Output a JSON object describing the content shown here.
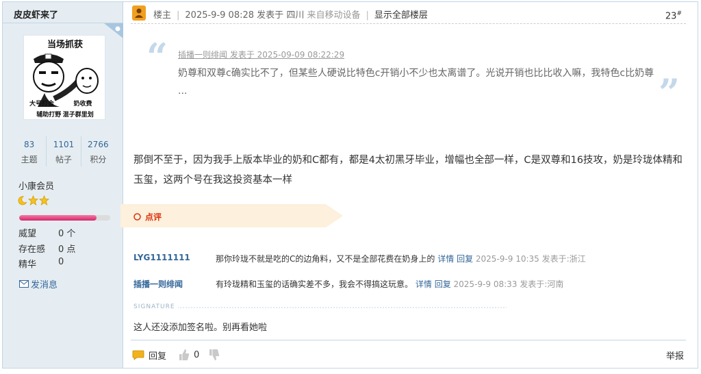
{
  "user": {
    "name": "皮皮虾来了",
    "avatar_caption_top": "当场抓获",
    "avatar_caption_left": "大号打金",
    "avatar_caption_right": "奶收费",
    "avatar_caption_bottom": "辅助打野 混子群里划",
    "stats": [
      {
        "value": "83",
        "label": "主题"
      },
      {
        "value": "1101",
        "label": "帖子"
      },
      {
        "value": "2766",
        "label": "积分"
      }
    ],
    "rank": "小康会员",
    "progress": 0.85,
    "attrs": [
      {
        "key": "威望",
        "value": "0 个"
      },
      {
        "key": "存在感",
        "value": "0 点"
      },
      {
        "key": "精华",
        "value": "0"
      }
    ],
    "send_message": "发消息"
  },
  "header": {
    "role": "楼主",
    "datetime": "2025-9-9 08:28",
    "posted_in_label": "发表于",
    "location": "四川",
    "device": "来自移动设备",
    "show_all": "显示全部楼层",
    "floor": "23",
    "floor_mark": "#"
  },
  "quote": {
    "meta": "插播一则绯闻 发表于 2025-09-09 08:22:29",
    "text": "奶尊和双尊c确实比不了，但某些人硬说比特色c开销小不少也太离谱了。光说开销也比比收入嘛，我特色c比奶尊 ..."
  },
  "post": {
    "body": "那倒不至于，因为我手上版本毕业的奶和C都有，都是4太初黑牙毕业，增幅也全部一样，C是双尊和16技攻，奶是玲珑体精和玉玺，这两个号在我这投资基本一样"
  },
  "comments": {
    "tab_label": "点评",
    "items": [
      {
        "user": "LYG1111111",
        "text": "那你玲珑不就是吃的C的边角料，又不是全部花费在奶身上的",
        "detail": "详情",
        "reply": "回复",
        "meta": "2025-9-9 10:35 发表于:浙江"
      },
      {
        "user": "插播一则绯闻",
        "text": "有玲珑精和玉玺的话确实差不多，我会不得搞这玩意。",
        "detail": "详情",
        "reply": "回复",
        "meta": "2025-9-9 08:33 发表于:河南"
      }
    ]
  },
  "signature": {
    "label": "SIGNATURE",
    "text": "这人还没添加签名啦。别再看她啦"
  },
  "footer": {
    "reply": "回复",
    "likes": "0",
    "report": "举报"
  },
  "colors": {
    "sidebar_bg": "#e5edf2",
    "link": "#336699",
    "comment_tab_bg": "#fdf0dc",
    "comment_accent": "#d9320f"
  }
}
